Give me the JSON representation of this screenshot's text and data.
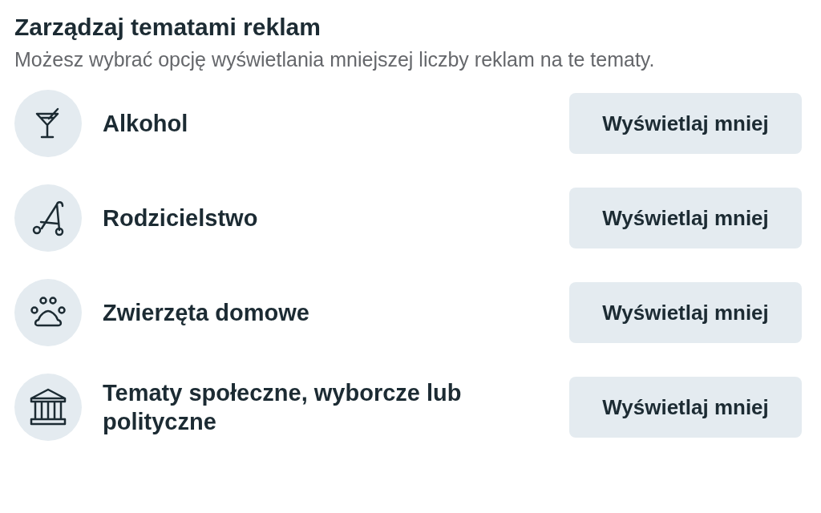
{
  "title": "Zarządzaj tematami reklam",
  "description": "Możesz wybrać opcję wyświetlania mniejszej liczby reklam na te tematy.",
  "topics": [
    {
      "kind": "cocktail",
      "label": "Alkohol",
      "button": "Wyświetlaj mniej"
    },
    {
      "kind": "stroller",
      "label": "Rodzicielstwo",
      "button": "Wyświetlaj mniej"
    },
    {
      "kind": "paw",
      "label": "Zwierzęta domowe",
      "button": "Wyświetlaj mniej"
    },
    {
      "kind": "building",
      "label": "Tematy społeczne, wyborcze lub polityczne",
      "button": "Wyświetlaj mniej"
    }
  ]
}
